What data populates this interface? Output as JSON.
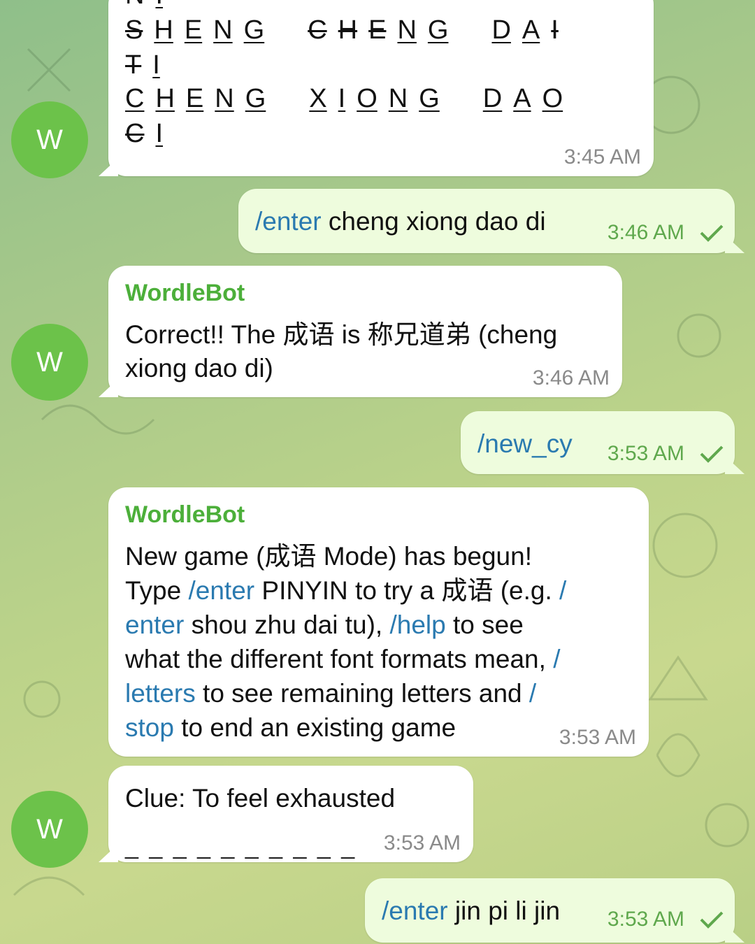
{
  "contact_initial": "W",
  "grid_message": {
    "rows": [
      [
        [
          "N",
          "s"
        ],
        [
          "I",
          "u"
        ]
      ],
      [
        [
          "S",
          "s"
        ],
        [
          "H",
          "u"
        ],
        [
          "E",
          "u"
        ],
        [
          "N",
          "u"
        ],
        [
          "G",
          "u"
        ],
        [
          "|",
          ""
        ],
        [
          "C",
          "s"
        ],
        [
          "H",
          "s"
        ],
        [
          "E",
          "s"
        ],
        [
          "N",
          "u"
        ],
        [
          "G",
          "u"
        ],
        [
          "|",
          ""
        ],
        [
          "D",
          "u"
        ],
        [
          "A",
          "u"
        ],
        [
          "I",
          "s"
        ]
      ],
      [
        [
          "T",
          "s"
        ],
        [
          "I",
          "u"
        ]
      ],
      [
        [
          "C",
          "u"
        ],
        [
          "H",
          "u"
        ],
        [
          "E",
          "u"
        ],
        [
          "N",
          "u"
        ],
        [
          "G",
          "u"
        ],
        [
          "|",
          ""
        ],
        [
          "X",
          "u"
        ],
        [
          "I",
          "u"
        ],
        [
          "O",
          "u"
        ],
        [
          "N",
          "u"
        ],
        [
          "G",
          "u"
        ],
        [
          "|",
          ""
        ],
        [
          "D",
          "u"
        ],
        [
          "A",
          "u"
        ],
        [
          "O",
          "u"
        ]
      ],
      [
        [
          "C",
          "s"
        ],
        [
          "I",
          "u"
        ]
      ]
    ],
    "time": "3:45 AM"
  },
  "msg_enter1": {
    "cmd": "/enter",
    "text": " cheng xiong dao di",
    "time": "3:46 AM"
  },
  "msg_correct": {
    "sender": "WordleBot",
    "line1": "Correct!! The 成语 is 称兄道弟 (cheng",
    "line2": "xiong dao di)",
    "time": "3:46 AM"
  },
  "msg_new": {
    "cmd": "/new_cy",
    "time": "3:53 AM"
  },
  "msg_newgame": {
    "sender": "WordleBot",
    "l1": "New game (成语 Mode) has begun!",
    "l2a": "Type ",
    "l2cmd": "/enter",
    "l2b": " PINYIN to try a 成语 (e.g. ",
    "l2cmd2": "/",
    "l3cmd": "enter",
    "l3a": " shou zhu dai tu), ",
    "l3cmd2": "/help",
    "l3b": " to see",
    "l4a": "what the different font formats mean, ",
    "l4cmd": "/",
    "l5cmd": "letters",
    "l5a": " to see remaining letters and ",
    "l5cmd2": "/",
    "l6cmd": "stop",
    "l6a": " to end an existing game",
    "time": "3:53 AM"
  },
  "msg_clue": {
    "text": "Clue: To feel exhausted",
    "blanks": "_ _ _   _ _   _ _   _ _ _",
    "time": "3:53 AM"
  },
  "msg_enter2": {
    "cmd": "/enter",
    "text": " jin pi li jin",
    "time": "3:53 AM"
  },
  "colors": {
    "accent": "#4caf3a",
    "link": "#2a7ab0",
    "avatar": "#6cc24a",
    "outgoing": "#eefcdd"
  }
}
